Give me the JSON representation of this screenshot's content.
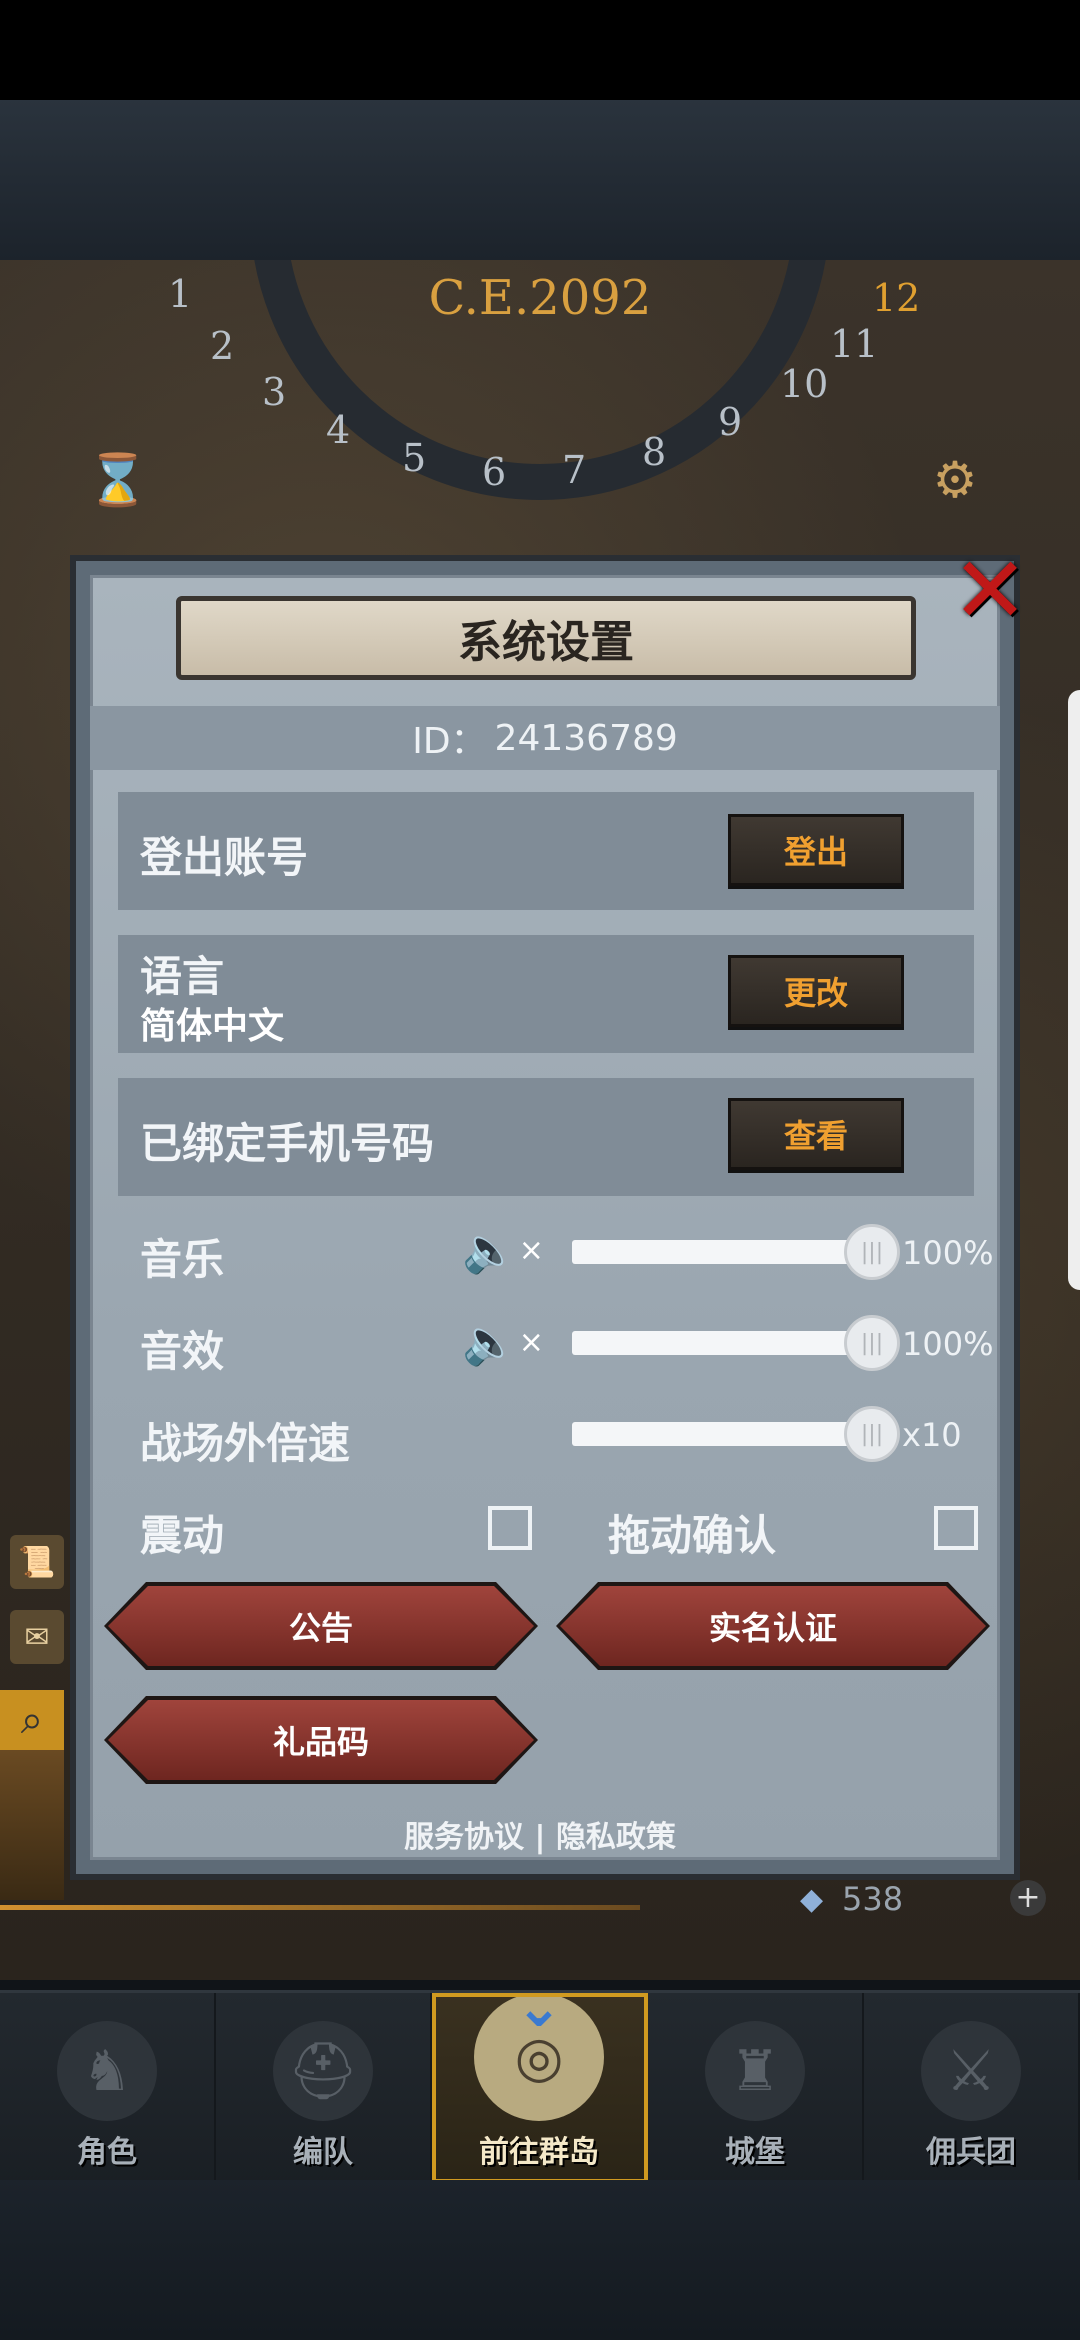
{
  "game": {
    "year": "C.E.2092",
    "dial_numbers": [
      "1",
      "2",
      "3",
      "4",
      "5",
      "6",
      "7",
      "8",
      "9",
      "10",
      "11",
      "12"
    ],
    "crystal_value": "538",
    "plus_symbol": "+"
  },
  "dialog": {
    "title": "系统设置",
    "id_label": "ID：",
    "id_value": "24136789",
    "close_symbol": "✕",
    "rows": [
      {
        "label": "登出账号",
        "button": "登出"
      },
      {
        "label": "语言",
        "sub": "简体中文",
        "button": "更改"
      },
      {
        "label": "已绑定手机号码",
        "button": "查看"
      }
    ],
    "music": {
      "label": "音乐",
      "level_percent": 100,
      "value_text": "100%"
    },
    "sfx": {
      "label": "音效",
      "level_percent": 100,
      "value_text": "100%"
    },
    "speed": {
      "label": "战场外倍速",
      "level_percent": 100,
      "value_text": "x10"
    },
    "vibration": {
      "label": "震动",
      "checked": false
    },
    "drag_confirm": {
      "label": "拖动确认",
      "checked": false
    },
    "buttons": {
      "announcement": "公告",
      "realname": "实名认证",
      "gift_code": "礼品码"
    },
    "footer": {
      "service": "服务协议",
      "separator": "|",
      "privacy": "隐私政策"
    }
  },
  "nav": {
    "items": [
      {
        "label": "角色",
        "icon": "knight-icon"
      },
      {
        "label": "编队",
        "icon": "helmet-icon"
      },
      {
        "label": "前往群岛",
        "icon": "globe-icon",
        "active": true
      },
      {
        "label": "城堡",
        "icon": "castle-icon"
      },
      {
        "label": "佣兵团",
        "icon": "mercenary-icon"
      }
    ]
  },
  "colors": {
    "accent_orange": "#f0a030",
    "close_red": "#c01818",
    "nav_active_border": "#d09a20"
  }
}
